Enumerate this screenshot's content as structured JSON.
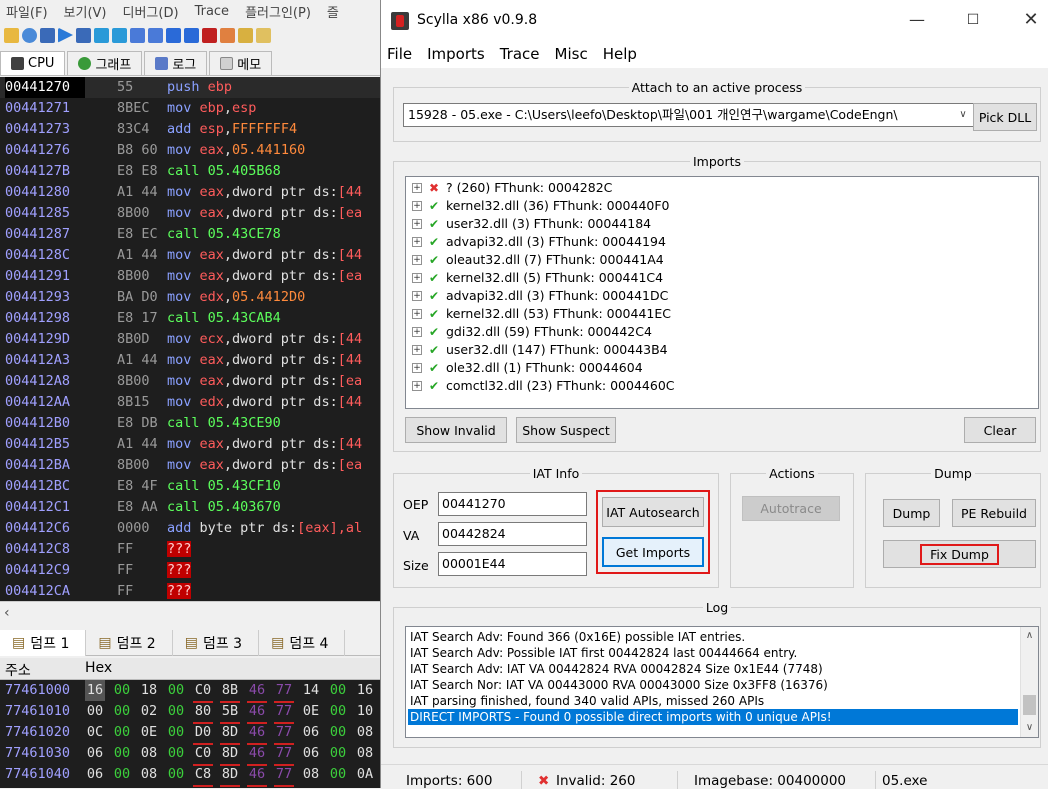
{
  "debugger": {
    "menu": [
      "파일(F)",
      "보기(V)",
      "디버그(D)",
      "Trace",
      "플러그인(P)",
      "즐"
    ],
    "tabs": [
      {
        "label": "CPU",
        "icon": "cpu-icon"
      },
      {
        "label": "그래프",
        "icon": "graph-icon"
      },
      {
        "label": "로그",
        "icon": "log-icon"
      },
      {
        "label": "메모",
        "icon": "notes-icon"
      }
    ],
    "disasm": [
      {
        "addr": "00441270",
        "bytes": "55",
        "ins": [
          [
            "push",
            "k-push"
          ],
          [
            " ebp",
            "k-reg"
          ]
        ]
      },
      {
        "addr": "00441271",
        "bytes": "8BEC",
        "ins": [
          [
            "mov ",
            "k-mov"
          ],
          [
            "ebp",
            "k-reg"
          ],
          [
            ",",
            "k-txt"
          ],
          [
            "esp",
            "k-reg"
          ]
        ]
      },
      {
        "addr": "00441273",
        "bytes": "83C4",
        "ins": [
          [
            "add ",
            "k-add"
          ],
          [
            "esp",
            "k-reg"
          ],
          [
            ",",
            "k-txt"
          ],
          [
            "FFFFFFF4",
            "k-num"
          ]
        ]
      },
      {
        "addr": "00441276",
        "bytes": "B8 60",
        "ins": [
          [
            "mov ",
            "k-mov"
          ],
          [
            "eax",
            "k-reg"
          ],
          [
            ",",
            "k-txt"
          ],
          [
            "05.441160",
            "k-num"
          ]
        ]
      },
      {
        "addr": "0044127B",
        "bytes": "E8 E8",
        "ins": [
          [
            "call ",
            "k-call"
          ],
          [
            "05.405B68",
            "k-call"
          ]
        ]
      },
      {
        "addr": "00441280",
        "bytes": "A1 44",
        "ins": [
          [
            "mov ",
            "k-mov"
          ],
          [
            "eax",
            "k-reg"
          ],
          [
            ",dword ptr ds:",
            "k-txt"
          ],
          [
            "[44",
            "k-reg"
          ]
        ]
      },
      {
        "addr": "00441285",
        "bytes": "8B00",
        "ins": [
          [
            "mov ",
            "k-mov"
          ],
          [
            "eax",
            "k-reg"
          ],
          [
            ",dword ptr ds:",
            "k-txt"
          ],
          [
            "[ea",
            "k-reg"
          ]
        ]
      },
      {
        "addr": "00441287",
        "bytes": "E8 EC",
        "ins": [
          [
            "call ",
            "k-call"
          ],
          [
            "05.43CE78",
            "k-call"
          ]
        ]
      },
      {
        "addr": "0044128C",
        "bytes": "A1 44",
        "ins": [
          [
            "mov ",
            "k-mov"
          ],
          [
            "eax",
            "k-reg"
          ],
          [
            ",dword ptr ds:",
            "k-txt"
          ],
          [
            "[44",
            "k-reg"
          ]
        ]
      },
      {
        "addr": "00441291",
        "bytes": "8B00",
        "ins": [
          [
            "mov ",
            "k-mov"
          ],
          [
            "eax",
            "k-reg"
          ],
          [
            ",dword ptr ds:",
            "k-txt"
          ],
          [
            "[ea",
            "k-reg"
          ]
        ]
      },
      {
        "addr": "00441293",
        "bytes": "BA D0",
        "ins": [
          [
            "mov ",
            "k-mov"
          ],
          [
            "edx",
            "k-reg"
          ],
          [
            ",",
            "k-txt"
          ],
          [
            "05.4412D0",
            "k-num"
          ]
        ]
      },
      {
        "addr": "00441298",
        "bytes": "E8 17",
        "ins": [
          [
            "call ",
            "k-call"
          ],
          [
            "05.43CAB4",
            "k-call"
          ]
        ]
      },
      {
        "addr": "0044129D",
        "bytes": "8B0D",
        "ins": [
          [
            "mov ",
            "k-mov"
          ],
          [
            "ecx",
            "k-reg"
          ],
          [
            ",dword ptr ds:",
            "k-txt"
          ],
          [
            "[44",
            "k-reg"
          ]
        ]
      },
      {
        "addr": "004412A3",
        "bytes": "A1 44",
        "ins": [
          [
            "mov ",
            "k-mov"
          ],
          [
            "eax",
            "k-reg"
          ],
          [
            ",dword ptr ds:",
            "k-txt"
          ],
          [
            "[44",
            "k-reg"
          ]
        ]
      },
      {
        "addr": "004412A8",
        "bytes": "8B00",
        "ins": [
          [
            "mov ",
            "k-mov"
          ],
          [
            "eax",
            "k-reg"
          ],
          [
            ",dword ptr ds:",
            "k-txt"
          ],
          [
            "[ea",
            "k-reg"
          ]
        ]
      },
      {
        "addr": "004412AA",
        "bytes": "8B15",
        "ins": [
          [
            "mov ",
            "k-mov"
          ],
          [
            "edx",
            "k-reg"
          ],
          [
            ",dword ptr ds:",
            "k-txt"
          ],
          [
            "[44",
            "k-reg"
          ]
        ]
      },
      {
        "addr": "004412B0",
        "bytes": "E8 DB",
        "ins": [
          [
            "call ",
            "k-call"
          ],
          [
            "05.43CE90",
            "k-call"
          ]
        ]
      },
      {
        "addr": "004412B5",
        "bytes": "A1 44",
        "ins": [
          [
            "mov ",
            "k-mov"
          ],
          [
            "eax",
            "k-reg"
          ],
          [
            ",dword ptr ds:",
            "k-txt"
          ],
          [
            "[44",
            "k-reg"
          ]
        ]
      },
      {
        "addr": "004412BA",
        "bytes": "8B00",
        "ins": [
          [
            "mov ",
            "k-mov"
          ],
          [
            "eax",
            "k-reg"
          ],
          [
            ",dword ptr ds:",
            "k-txt"
          ],
          [
            "[ea",
            "k-reg"
          ]
        ]
      },
      {
        "addr": "004412BC",
        "bytes": "E8 4F",
        "ins": [
          [
            "call ",
            "k-call"
          ],
          [
            "05.43CF10",
            "k-call"
          ]
        ]
      },
      {
        "addr": "004412C1",
        "bytes": "E8 AA",
        "ins": [
          [
            "call ",
            "k-call"
          ],
          [
            "05.403670",
            "k-call"
          ]
        ]
      },
      {
        "addr": "004412C6",
        "bytes": "0000",
        "ins": [
          [
            "add ",
            "k-add"
          ],
          [
            "byte ptr ds:",
            "k-txt"
          ],
          [
            "[eax]",
            "k-reg"
          ],
          [
            ",al",
            "k-reg"
          ]
        ]
      },
      {
        "addr": "004412C8",
        "bytes": "FF",
        "ins": [
          [
            "???",
            "k-bad"
          ]
        ]
      },
      {
        "addr": "004412C9",
        "bytes": "FF",
        "ins": [
          [
            "???",
            "k-bad"
          ]
        ]
      },
      {
        "addr": "004412CA",
        "bytes": "FF",
        "ins": [
          [
            "???",
            "k-bad"
          ]
        ]
      }
    ],
    "dump_tabs": [
      "덤프 1",
      "덤프 2",
      "덤프 3",
      "덤프 4"
    ],
    "dump_head": {
      "addr": "주소",
      "hex": "Hex"
    },
    "dump_rows": [
      {
        "addr": "77461000",
        "bytes": [
          "16",
          "00",
          "18",
          "00",
          "C0",
          "8B",
          "46",
          "77",
          "14",
          "00",
          "16"
        ]
      },
      {
        "addr": "77461010",
        "bytes": [
          "00",
          "00",
          "02",
          "00",
          "80",
          "5B",
          "46",
          "77",
          "0E",
          "00",
          "10"
        ]
      },
      {
        "addr": "77461020",
        "bytes": [
          "0C",
          "00",
          "0E",
          "00",
          "D0",
          "8D",
          "46",
          "77",
          "06",
          "00",
          "08"
        ]
      },
      {
        "addr": "77461030",
        "bytes": [
          "06",
          "00",
          "08",
          "00",
          "C0",
          "8D",
          "46",
          "77",
          "06",
          "00",
          "08"
        ]
      },
      {
        "addr": "77461040",
        "bytes": [
          "06",
          "00",
          "08",
          "00",
          "C8",
          "8D",
          "46",
          "77",
          "08",
          "00",
          "0A"
        ]
      }
    ]
  },
  "scylla": {
    "title": "Scylla x86 v0.9.8",
    "menu": [
      "File",
      "Imports",
      "Trace",
      "Misc",
      "Help"
    ],
    "attach": {
      "legend": "Attach to an active process",
      "process": "15928 - 05.exe - C:\\Users\\leefo\\Desktop\\파일\\001 개인연구\\wargame\\CodeEngn\\",
      "pick_dll": "Pick DLL"
    },
    "imports": {
      "legend": "Imports",
      "items": [
        {
          "status": "bad",
          "text": "? (260) FThunk: 0004282C"
        },
        {
          "status": "ok",
          "text": "kernel32.dll (36) FThunk: 000440F0"
        },
        {
          "status": "ok",
          "text": "user32.dll (3) FThunk: 00044184"
        },
        {
          "status": "ok",
          "text": "advapi32.dll (3) FThunk: 00044194"
        },
        {
          "status": "ok",
          "text": "oleaut32.dll (7) FThunk: 000441A4"
        },
        {
          "status": "ok",
          "text": "kernel32.dll (5) FThunk: 000441C4"
        },
        {
          "status": "ok",
          "text": "advapi32.dll (3) FThunk: 000441DC"
        },
        {
          "status": "ok",
          "text": "kernel32.dll (53) FThunk: 000441EC"
        },
        {
          "status": "ok",
          "text": "gdi32.dll (59) FThunk: 000442C4"
        },
        {
          "status": "ok",
          "text": "user32.dll (147) FThunk: 000443B4"
        },
        {
          "status": "ok",
          "text": "ole32.dll (1) FThunk: 00044604"
        },
        {
          "status": "ok",
          "text": "comctl32.dll (23) FThunk: 0004460C"
        }
      ],
      "show_invalid": "Show Invalid",
      "show_suspect": "Show Suspect",
      "clear": "Clear"
    },
    "iat": {
      "legend": "IAT Info",
      "oep_label": "OEP",
      "oep": "00441270",
      "va_label": "VA",
      "va": "00442824",
      "size_label": "Size",
      "size": "00001E44",
      "autosearch": "IAT Autosearch",
      "get_imports": "Get Imports"
    },
    "actions": {
      "legend": "Actions",
      "autotrace": "Autotrace"
    },
    "dump": {
      "legend": "Dump",
      "dump": "Dump",
      "pe_rebuild": "PE Rebuild",
      "fix_dump": "Fix Dump"
    },
    "log": {
      "legend": "Log",
      "lines": [
        "IAT Search Adv: Found 366 (0x16E) possible IAT entries.",
        "IAT Search Adv: Possible IAT first 00442824 last 00444664 entry.",
        "IAT Search Adv: IAT VA 00442824 RVA 00042824 Size 0x1E44 (7748)",
        "IAT Search Nor: IAT VA 00443000 RVA 00043000 Size 0x3FF8 (16376)",
        "IAT parsing finished, found 340 valid APIs, missed 260 APIs",
        "DIRECT IMPORTS - Found 0 possible direct imports with 0 unique APIs!"
      ],
      "selected_index": 5
    },
    "status": {
      "imports": "Imports: 600",
      "invalid": "Invalid: 260",
      "imagebase": "Imagebase: 00400000",
      "module": "05.exe"
    }
  }
}
